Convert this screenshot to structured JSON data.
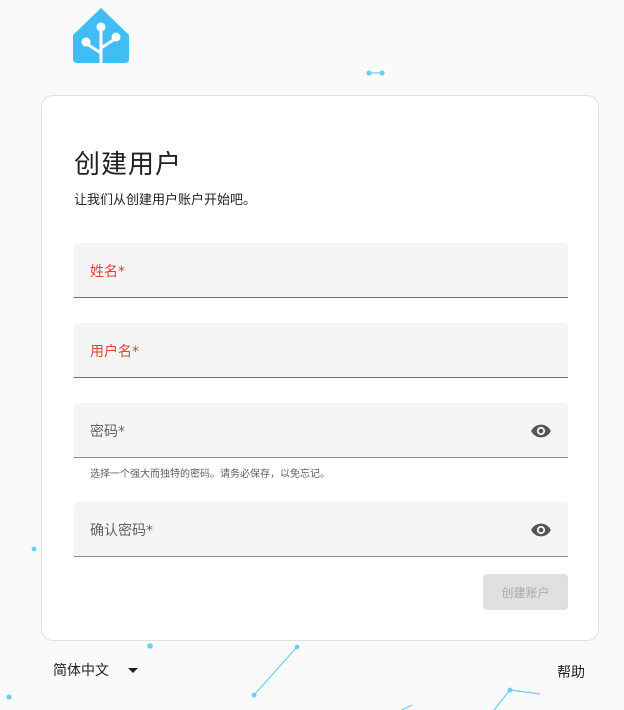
{
  "colors": {
    "brand": "#41bdf5",
    "error": "#db4437",
    "field_bg": "#f5f5f5",
    "disabled_button_bg": "#e0e0e0"
  },
  "header": {
    "logo_icon": "home-assistant-logo-icon"
  },
  "card": {
    "title": "创建用户",
    "subtitle": "让我们从创建用户账户开始吧。",
    "fields": {
      "name": {
        "label": "姓名*",
        "value": "",
        "state": "error"
      },
      "username": {
        "label": "用户名*",
        "value": "",
        "state": "error"
      },
      "password": {
        "label": "密码*",
        "value": "",
        "helper": "选择一个强大而独特的密码。请务必保存，以免忘记。",
        "toggle_icon": "eye-icon"
      },
      "confirm_password": {
        "label": "确认密码*",
        "value": "",
        "toggle_icon": "eye-icon"
      }
    },
    "submit_label": "创建账户"
  },
  "footer": {
    "language": "简体中文",
    "language_icon": "caret-down-icon",
    "help_label": "帮助"
  }
}
